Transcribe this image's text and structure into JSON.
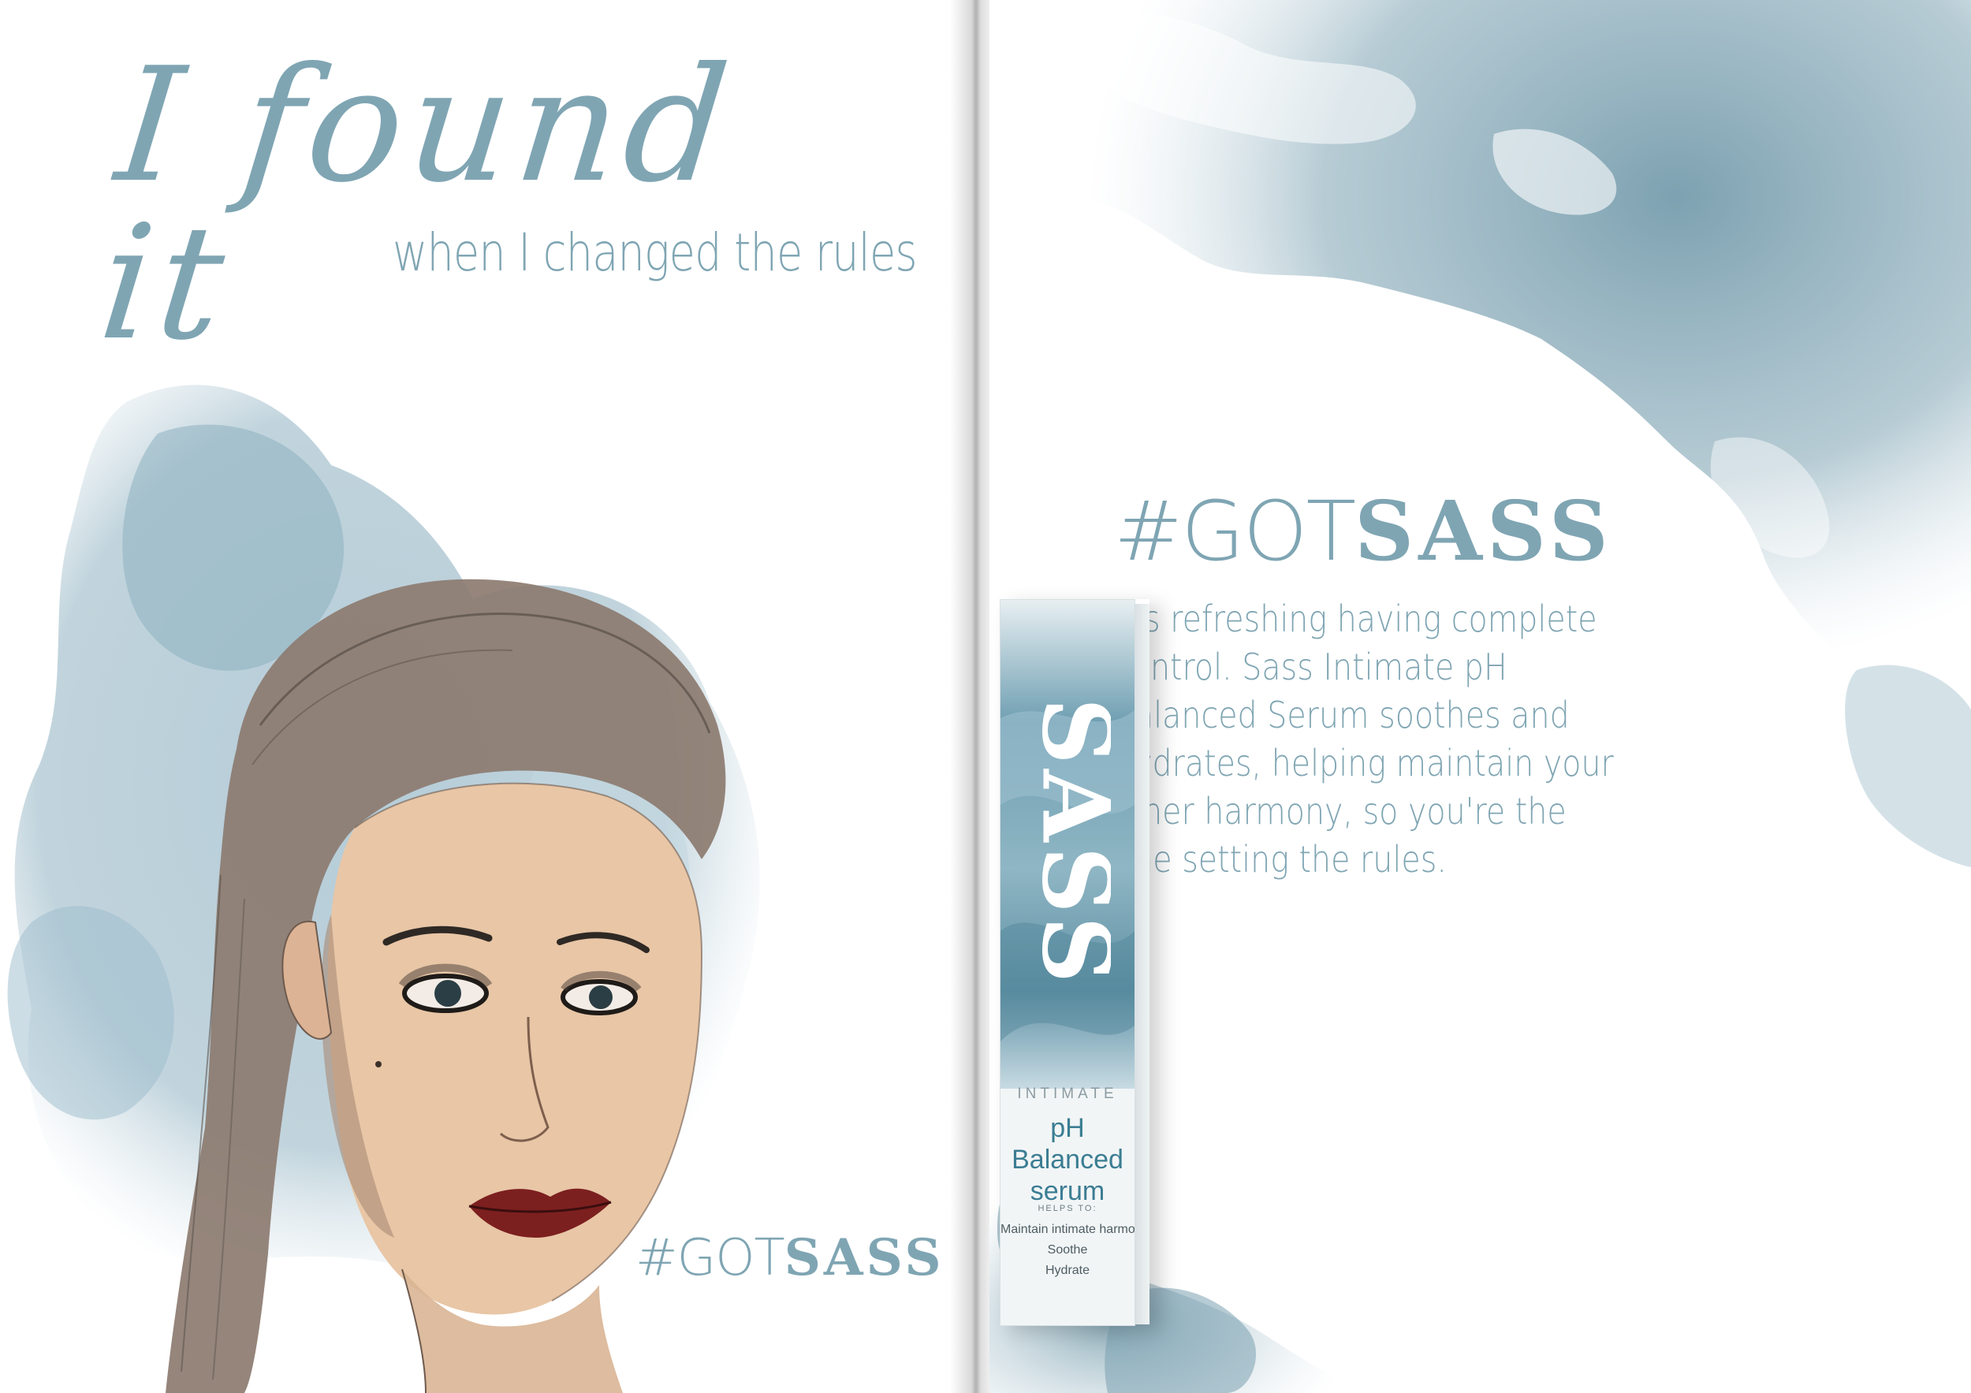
{
  "left_page": {
    "headline": "I found it",
    "subheadline": "when I changed the rules",
    "hashtag_prefix": "#GOT",
    "hashtag_brand": "SASS"
  },
  "right_page": {
    "hashtag_prefix": "#GOT",
    "hashtag_brand": "SASS",
    "body_lines": [
      "It's refreshing having complete",
      "control. Sass Intimate pH",
      "Balanced Serum soothes and",
      "hydrates, helping maintain your",
      "inner harmony, so you're the",
      "one setting the rules."
    ]
  },
  "product": {
    "logo": "SASS",
    "line": "INTIMATE",
    "title_line1": "pH Balanced",
    "title_line2": "serum",
    "helps_label": "HELPS TO:",
    "benefits": [
      "Maintain intimate harmony",
      "Soothe",
      "Hydrate"
    ]
  },
  "colors": {
    "accent": "#7fa5b3",
    "wash": "#7aa0b0",
    "box_title": "#3b7d93"
  }
}
